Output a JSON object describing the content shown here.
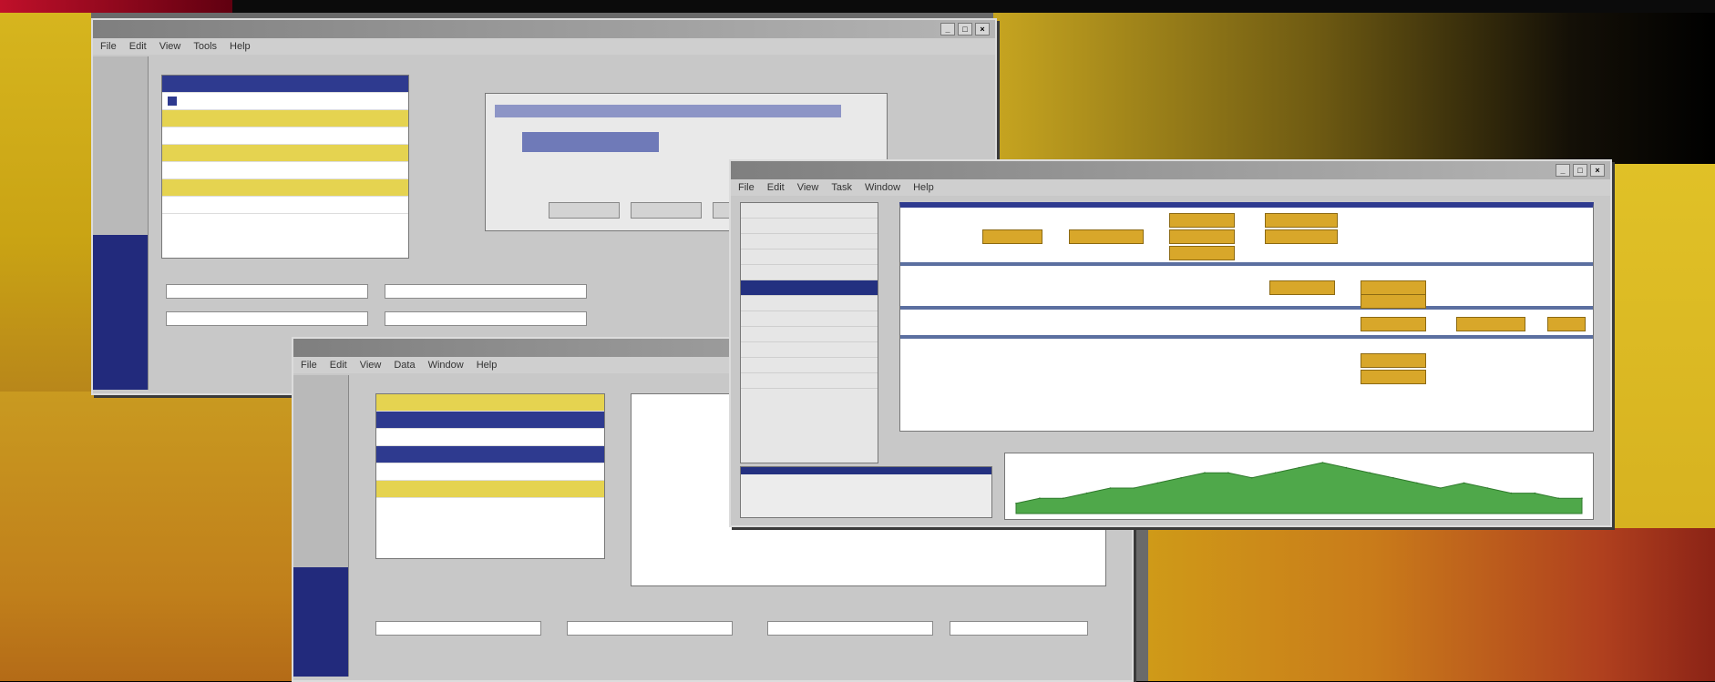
{
  "colors": {
    "title_active": "#7f7f7f",
    "selection": "#233080",
    "gantt_bar": "#d8a72a",
    "highlight_row": "#e5d350",
    "area_chart": "#4fa84a"
  },
  "win1": {
    "title": "",
    "menu": [
      "File",
      "Edit",
      "View",
      "Tools",
      "Help"
    ],
    "list_rows": [
      "",
      "",
      "",
      "",
      "",
      "",
      "",
      ""
    ],
    "buttons": [
      "",
      "",
      ""
    ]
  },
  "win2": {
    "title": "",
    "menu": [
      "File",
      "Edit",
      "View",
      "Data",
      "Window",
      "Help"
    ],
    "list_rows": [
      "",
      "",
      "",
      "",
      "",
      ""
    ],
    "footer_labels": [
      "",
      "",
      "",
      ""
    ]
  },
  "win3": {
    "title": "",
    "menu": [
      "File",
      "Edit",
      "View",
      "Task",
      "Window",
      "Help"
    ],
    "task_list": [
      "",
      "",
      "",
      "",
      "",
      "",
      "",
      "",
      "",
      "",
      "",
      ""
    ],
    "chart_data": {
      "type": "area",
      "values": [
        2,
        3,
        3,
        4,
        5,
        5,
        6,
        7,
        8,
        8,
        7,
        8,
        9,
        10,
        9,
        8,
        7,
        6,
        5,
        6,
        5,
        4,
        4,
        3,
        3
      ]
    }
  }
}
